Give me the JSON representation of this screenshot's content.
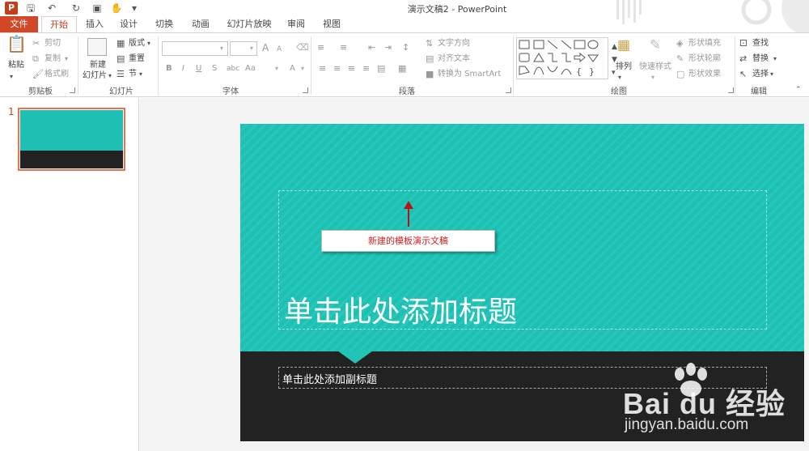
{
  "window": {
    "title": "演示文稿2 - PowerPoint",
    "app_icon": "P"
  },
  "qat": {
    "icons": [
      "powerpoint-app-icon",
      "save-icon",
      "undo-icon",
      "redo-icon",
      "slideshow-from-start-icon",
      "touch-mode-icon",
      "customize-qat-icon"
    ]
  },
  "tabs": [
    {
      "label": "文件"
    },
    {
      "label": "开始"
    },
    {
      "label": "插入"
    },
    {
      "label": "设计"
    },
    {
      "label": "切换"
    },
    {
      "label": "动画"
    },
    {
      "label": "幻灯片放映"
    },
    {
      "label": "审阅"
    },
    {
      "label": "视图"
    }
  ],
  "ribbon": {
    "clipboard": {
      "paste": "粘贴",
      "cut": "剪切",
      "copy": "复制",
      "format_painter": "格式刷",
      "label": "剪贴板"
    },
    "slides": {
      "new_slide_line1": "新建",
      "new_slide_line2": "幻灯片",
      "layout": "版式",
      "reset": "重置",
      "section": "节",
      "label": "幻灯片"
    },
    "font": {
      "label": "字体",
      "bold": "B",
      "italic": "I",
      "underline": "U",
      "strike": "S",
      "spacing": "abc",
      "size_up": "A",
      "size_down": "A",
      "clear": "A",
      "case": "Aa",
      "color": "A"
    },
    "paragraph": {
      "text_direction": "文字方向",
      "align_text": "对齐文本",
      "convert_smartart": "转换为 SmartArt",
      "label": "段落"
    },
    "drawing": {
      "arrange": "排列",
      "quick_styles": "快速样式",
      "shape_fill": "形状填充",
      "shape_outline": "形状轮廓",
      "shape_effects": "形状效果",
      "label": "绘图"
    },
    "editing": {
      "find": "查找",
      "replace": "替换",
      "select": "选择",
      "label": "编辑"
    }
  },
  "thumbnail": {
    "number": "1"
  },
  "slide": {
    "title_placeholder": "单击此处添加标题",
    "subtitle_placeholder": "单击此处添加副标题",
    "teal_color": "#1dc0b2",
    "dark_color": "#222222"
  },
  "annotation": {
    "callout_text": "新建的模板演示文稿",
    "color": "#d21f1f"
  },
  "watermark": {
    "brand": "Bai du 经验",
    "url": "jingyan.baidu.com"
  }
}
